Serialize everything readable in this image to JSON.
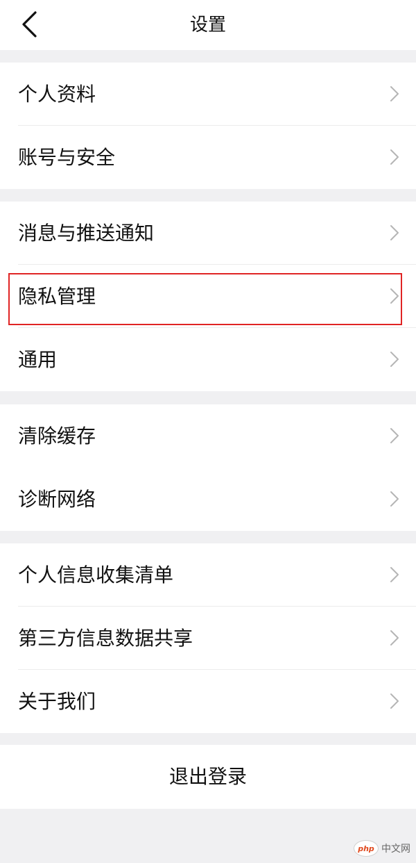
{
  "header": {
    "title": "设置",
    "back_icon": "chevron-left-icon"
  },
  "groups": [
    {
      "items": [
        {
          "label": "个人资料"
        },
        {
          "label": "账号与安全"
        }
      ]
    },
    {
      "items": [
        {
          "label": "消息与推送通知"
        },
        {
          "label": "隐私管理",
          "highlighted": true
        },
        {
          "label": "通用"
        }
      ]
    },
    {
      "items": [
        {
          "label": "清除缓存"
        },
        {
          "label": "诊断网络"
        }
      ]
    },
    {
      "items": [
        {
          "label": "个人信息收集清单"
        },
        {
          "label": "第三方信息数据共享"
        },
        {
          "label": "关于我们"
        }
      ]
    }
  ],
  "logout": {
    "label": "退出登录"
  },
  "watermark": {
    "logo_text": "php",
    "text": "中文网"
  },
  "colors": {
    "background": "#f0f0f2",
    "card": "#ffffff",
    "highlight_border": "#e02424",
    "chevron": "#b5b5b5"
  }
}
